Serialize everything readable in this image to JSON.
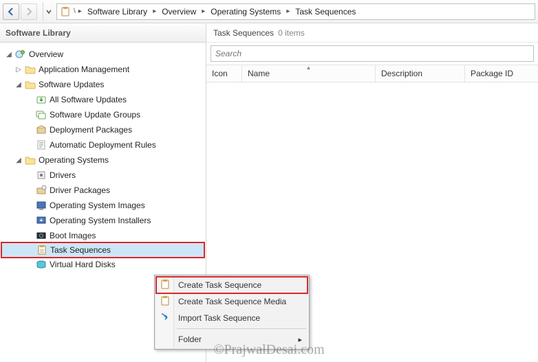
{
  "breadcrumb": [
    "Software Library",
    "Overview",
    "Operating Systems",
    "Task Sequences"
  ],
  "sidebar": {
    "title": "Software Library",
    "nodes": {
      "overview": "Overview",
      "appmgmt": "Application Management",
      "swupdates": "Software Updates",
      "allswu": "All Software Updates",
      "swugroups": "Software Update Groups",
      "deploypkg": "Deployment Packages",
      "autodeploy": "Automatic Deployment Rules",
      "os": "Operating Systems",
      "drivers": "Drivers",
      "driverpkg": "Driver Packages",
      "osimages": "Operating System Images",
      "osinstallers": "Operating System Installers",
      "bootimg": "Boot Images",
      "taskseq": "Task Sequences",
      "vhd": "Virtual Hard Disks"
    }
  },
  "content": {
    "title": "Task Sequences",
    "count_label": "0 items",
    "search_placeholder": "Search",
    "columns": {
      "icon": "Icon",
      "name": "Name",
      "desc": "Description",
      "pkgid": "Package ID"
    }
  },
  "context_menu": {
    "create": "Create Task Sequence",
    "media": "Create Task Sequence Media",
    "import": "Import Task Sequence",
    "folder": "Folder"
  },
  "watermark": "©PrajwalDesai.com"
}
